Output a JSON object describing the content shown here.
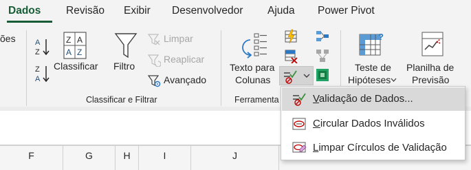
{
  "tabs": {
    "items": [
      {
        "label": "Dados",
        "active": true
      },
      {
        "label": "Revisão"
      },
      {
        "label": "Exibir"
      },
      {
        "label": "Desenvolvedor"
      },
      {
        "label": "Ajuda"
      },
      {
        "label": "Power Pivot"
      }
    ]
  },
  "ribbon": {
    "left_fragment": "ões",
    "sort_filter": {
      "classificar": "Classificar",
      "filtro": "Filtro",
      "limpar": "Limpar",
      "reaplicar": "Reaplicar",
      "avancado": "Avançado",
      "group_label": "Classificar e Filtrar"
    },
    "data_tools": {
      "texto_para_colunas_line1": "Texto para",
      "texto_para_colunas_line2": "Colunas",
      "group_label_partial": "Ferramenta"
    },
    "forecast": {
      "teste_line1": "Teste de",
      "teste_line2": "Hipóteses",
      "planilha_line1": "Planilha de",
      "planilha_line2": "Previsão"
    }
  },
  "columns": [
    "F",
    "G",
    "H",
    "I",
    "J"
  ],
  "menu": {
    "items": [
      {
        "accel": "V",
        "rest": "alidação de Dados...",
        "highlighted": true
      },
      {
        "accel": "C",
        "rest": "ircular Dados Inválidos",
        "highlighted": false
      },
      {
        "accel": "L",
        "rest": "impar Círculos de Validação",
        "highlighted": false
      }
    ]
  },
  "colors": {
    "accent": "#185c37",
    "ribbon_bg": "#f3f3f3",
    "menu_highlight": "#d9d9d9",
    "disabled_text": "#a6a6a6"
  }
}
